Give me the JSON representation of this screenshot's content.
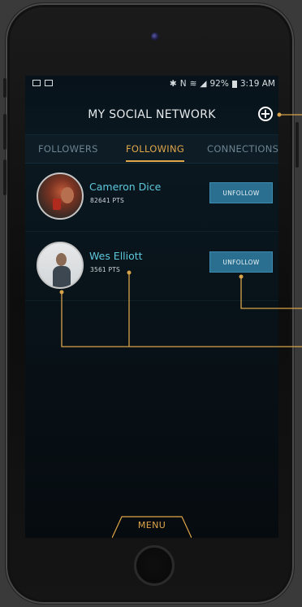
{
  "status_bar": {
    "battery": "92%",
    "time": "3:19 AM"
  },
  "header": {
    "title": "MY SOCIAL NETWORK",
    "add_icon": "plus-circle-icon"
  },
  "tabs": [
    {
      "label": "FOLLOWERS",
      "active": false
    },
    {
      "label": "FOLLOWING",
      "active": true
    },
    {
      "label": "CONNECTIONS",
      "active": false
    }
  ],
  "following": [
    {
      "name": "Cameron Dice",
      "points": "82641 PTS",
      "action": "UNFOLLOW"
    },
    {
      "name": "Wes Elliott",
      "points": "3561 PTS",
      "action": "UNFOLLOW"
    }
  ],
  "menu": {
    "label": "MENU"
  },
  "colors": {
    "accent": "#e0a64a",
    "name": "#5ec8dc",
    "button": "#2a6f90",
    "annotation": "#d8a24a"
  }
}
